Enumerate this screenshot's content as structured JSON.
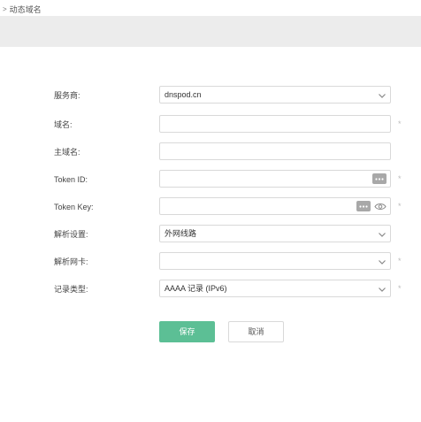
{
  "breadcrumb": {
    "label": "动态域名"
  },
  "form": {
    "provider": {
      "label": "服务商:",
      "value": "dnspod.cn"
    },
    "domain": {
      "label": "域名:",
      "value": ""
    },
    "main_domain": {
      "label": "主域名:",
      "value": ""
    },
    "token_id": {
      "label": "Token ID:",
      "value": ""
    },
    "token_key": {
      "label": "Token Key:",
      "value": ""
    },
    "resolve_setting": {
      "label": "解析设置:",
      "value": "外网线路"
    },
    "resolve_nic": {
      "label": "解析网卡:",
      "value": ""
    },
    "record_type": {
      "label": "记录类型:",
      "value": "AAAA 记录 (IPv6)"
    },
    "required_mark": "*"
  },
  "actions": {
    "save_label": "保存",
    "cancel_label": "取消"
  },
  "colors": {
    "accent": "#5cbf95",
    "band": "#ececec",
    "border": "#d9d9d9"
  }
}
